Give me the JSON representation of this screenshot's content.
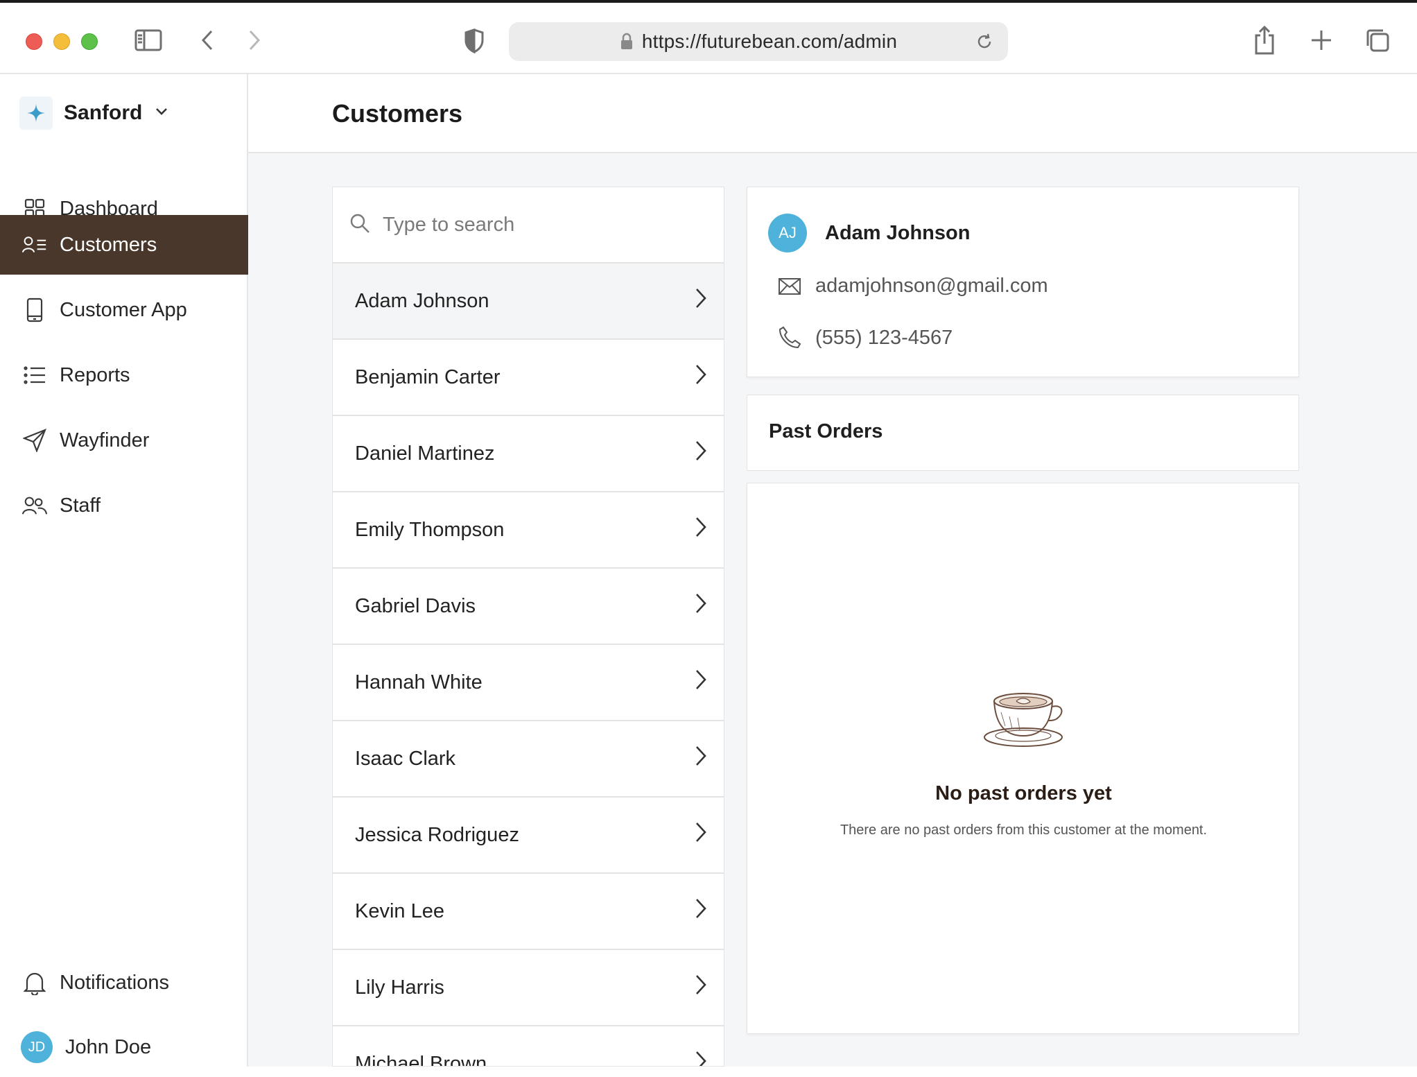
{
  "browser": {
    "url": "https://futurebean.com/admin"
  },
  "sidebar": {
    "org_name": "Sanford",
    "items": [
      {
        "label": "Dashboard",
        "icon": "grid-icon"
      },
      {
        "label": "Customers",
        "icon": "customers-list-icon",
        "active": true
      },
      {
        "label": "Customer App",
        "icon": "mobile-phone-icon"
      },
      {
        "label": "Reports",
        "icon": "list-icon"
      },
      {
        "label": "Wayfinder",
        "icon": "navigation-arrow-icon"
      },
      {
        "label": "Staff",
        "icon": "users-icon"
      }
    ],
    "notifications_label": "Notifications",
    "user": {
      "initials": "JD",
      "name": "John Doe"
    }
  },
  "main": {
    "title": "Customers",
    "search": {
      "placeholder": "Type to search",
      "value": ""
    },
    "customers": [
      "Adam Johnson",
      "Benjamin Carter",
      "Daniel Martinez",
      "Emily Thompson",
      "Gabriel Davis",
      "Hannah White",
      "Isaac Clark",
      "Jessica Rodriguez",
      "Kevin Lee",
      "Lily Harris",
      "Michael Brown"
    ],
    "selected_customer": {
      "initials": "AJ",
      "name": "Adam Johnson",
      "email": "adamjohnson@gmail.com",
      "phone": "(555) 123-4567"
    },
    "past_orders": {
      "title": "Past Orders",
      "empty_title": "No past orders yet",
      "empty_message": "There are no past orders from this customer at the moment."
    }
  },
  "colors": {
    "accent_active": "#4a372b",
    "avatar": "#4eb2da",
    "background": "#f5f6f7"
  }
}
